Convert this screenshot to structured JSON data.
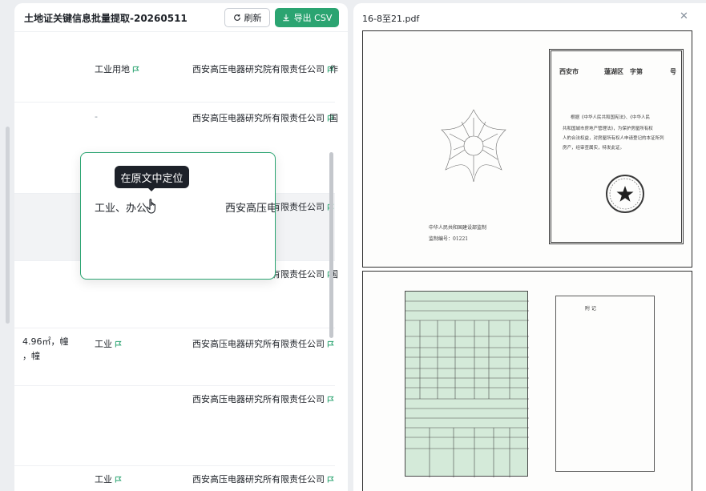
{
  "left": {
    "title": "土地证关键信息批量提取-20260511",
    "refresh_label": "刷新",
    "export_label": "导出 CSV",
    "rows": [
      {
        "use": "工业用地",
        "owner": "西安高压电器研究院有限责任公司",
        "extra": "作"
      },
      {
        "use": "-",
        "owner": "西安高压电器研究所有限责任公司",
        "extra": "国"
      },
      {
        "use": "",
        "owner": "西安高压电器研究所有限责任公司",
        "extra": ""
      },
      {
        "use": "",
        "owner": "西安高压电器研究所有限责任公司",
        "extra": "国"
      },
      {
        "area_line1": "4.96㎡，幢",
        "area_line2": "，幢",
        "use": "工业",
        "owner": "西安高压电器研究所有限责任公司",
        "extra": ""
      },
      {
        "use": "",
        "owner": "西安高压电器研究所有限责任公司",
        "extra": ""
      },
      {
        "use": "工业",
        "owner": "西安高压电器研究所有限责任公司",
        "extra": ""
      }
    ],
    "popover": {
      "use": "工业、办公",
      "owner_partial": "西安高压电"
    },
    "tooltip": "在原文中定位"
  },
  "right": {
    "title": "16-8至21.pdf",
    "close_icon": "close-icon",
    "page1": {
      "header": "西安市",
      "header2": "蓮湖区",
      "header3": "字第",
      "header4": "号",
      "body1": "根据《中华人民共和国宪法》、《中华人民",
      "body2": "共和国城市房地产管理法》，为保护房屋所有权",
      "body3": "人的合法权益，对房屋所有权人申请登记的本证所列",
      "body4": "房产，经审查属实，特发此证。",
      "issuer": "中华人民共和国建设部监制",
      "serial_label": "监制编号：",
      "serial_no": "01221"
    },
    "page2": {
      "notes_title": "附          记"
    }
  },
  "colors": {
    "accent": "#2ba471",
    "tooltip_bg": "#1d2129"
  }
}
